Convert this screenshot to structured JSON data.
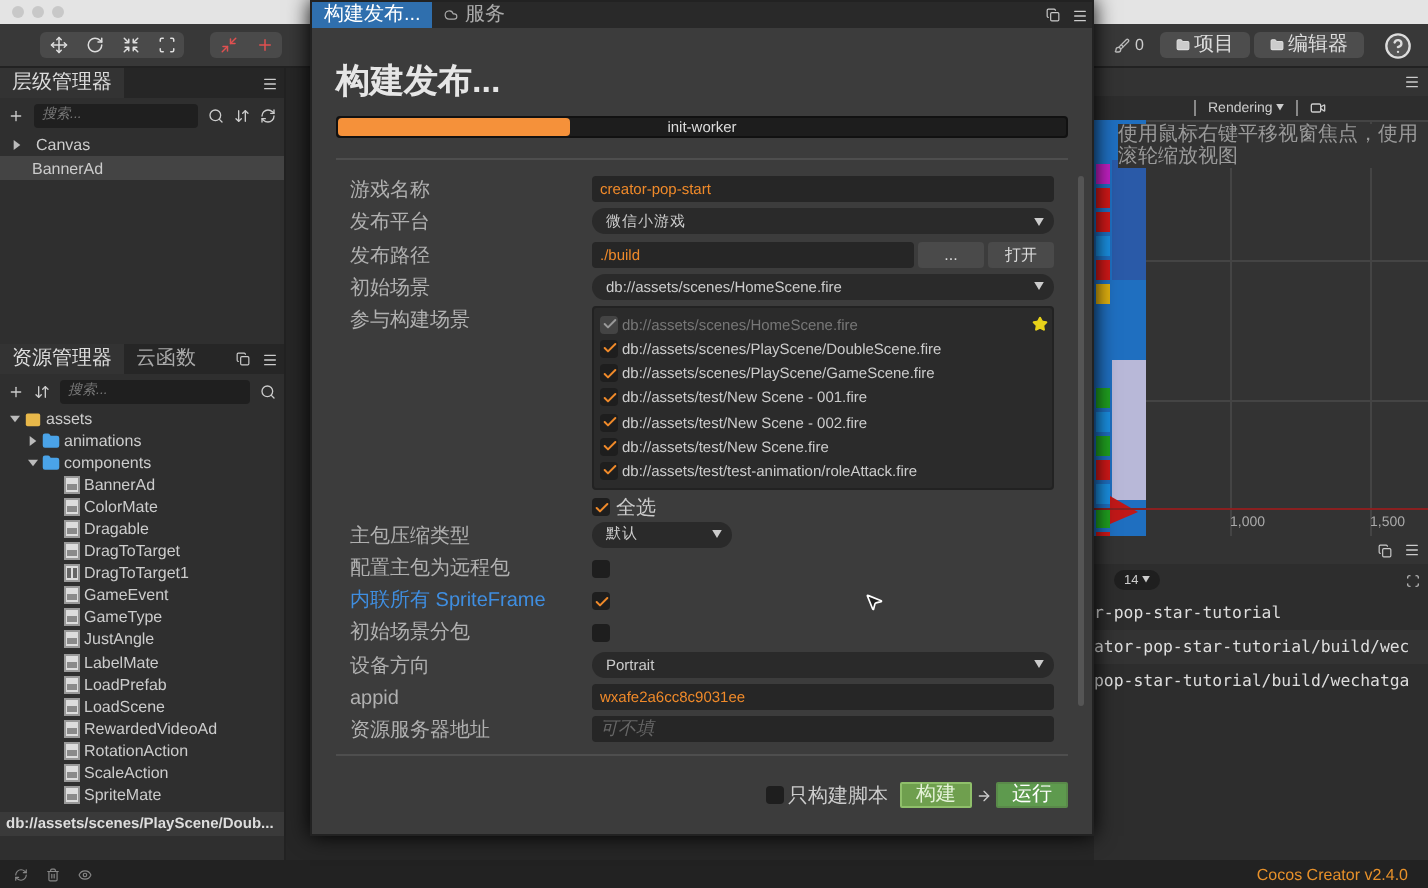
{
  "toolbar": {
    "counter": "0",
    "buttons": [
      "项目",
      "编辑器"
    ]
  },
  "hierarchy": {
    "tab": "层级管理器",
    "search": {
      "placeholder": "搜索..."
    },
    "items": [
      {
        "label": "Canvas",
        "has_caret": true,
        "selected": false
      },
      {
        "label": "BannerAd",
        "has_caret": false,
        "selected": true
      }
    ]
  },
  "assets": {
    "tabs": [
      {
        "label": "资源管理器",
        "selected": true
      },
      {
        "label": "云函数",
        "selected": false
      }
    ],
    "search": {
      "placeholder": "搜索..."
    },
    "tree": [
      {
        "label": "assets",
        "kind": "root",
        "expanded": true,
        "children": [
          {
            "label": "animations",
            "kind": "folder",
            "expanded": false
          },
          {
            "label": "components",
            "kind": "folder",
            "expanded": true,
            "children": [
              {
                "label": "BannerAd",
                "kind": "ts"
              },
              {
                "label": "ColorMate",
                "kind": "ts"
              },
              {
                "label": "Dragable",
                "kind": "ts"
              },
              {
                "label": "DragToTarget",
                "kind": "ts"
              },
              {
                "label": "DragToTarget1",
                "kind": "js"
              },
              {
                "label": "GameEvent",
                "kind": "ts"
              },
              {
                "label": "GameType",
                "kind": "ts"
              },
              {
                "label": "JustAngle",
                "kind": "ts"
              },
              {
                "label": "LabelMate",
                "kind": "ts"
              },
              {
                "label": "LoadPrefab",
                "kind": "ts"
              },
              {
                "label": "LoadScene",
                "kind": "ts"
              },
              {
                "label": "RewardedVideoAd",
                "kind": "ts"
              },
              {
                "label": "RotationAction",
                "kind": "ts"
              },
              {
                "label": "ScaleAction",
                "kind": "ts"
              },
              {
                "label": "SpriteMate",
                "kind": "ts"
              }
            ]
          }
        ]
      }
    ],
    "path": "db://assets/scenes/PlayScene/Doub..."
  },
  "scene": {
    "render_mode": "Rendering",
    "hint": "使用鼠标右键平移视窗焦点，使用滚轮缩放视图",
    "axis_labels": [
      "1,000",
      "1,500"
    ]
  },
  "console": {
    "filter": "14",
    "lines": [
      "r-pop-star-tutorial",
      "ator-pop-star-tutorial/build/wec",
      "pop-star-tutorial/build/wechatga"
    ]
  },
  "status_bar": {
    "version": "Cocos Creator v2.4.0"
  },
  "build_dialog": {
    "tabs": [
      {
        "label": "构建发布...",
        "selected": true
      },
      {
        "label": "服务",
        "selected": false
      }
    ],
    "title": "构建发布...",
    "progress": {
      "level": 0.32,
      "label": "init-worker"
    },
    "fields": [
      {
        "kind": "text",
        "label": "游戏名称",
        "value": "creator-pop-start"
      },
      {
        "kind": "select",
        "label": "发布平台",
        "value": "微信小游戏"
      },
      {
        "kind": "path",
        "label": "发布路径",
        "value": "./build",
        "buttons": [
          "...",
          "打开"
        ]
      },
      {
        "kind": "select",
        "label": "初始场景",
        "value": "db://assets/scenes/HomeScene.fire"
      },
      {
        "kind": "scenes",
        "label": "参与构建场景",
        "scenes": [
          {
            "path": "db://assets/scenes/HomeScene.fire",
            "checked": true,
            "disabled": true,
            "starred": true
          },
          {
            "path": "db://assets/scenes/PlayScene/DoubleScene.fire",
            "checked": true,
            "disabled": false,
            "starred": false
          },
          {
            "path": "db://assets/scenes/PlayScene/GameScene.fire",
            "checked": true,
            "disabled": false,
            "starred": false
          },
          {
            "path": "db://assets/test/New Scene - 001.fire",
            "checked": true,
            "disabled": false,
            "starred": false
          },
          {
            "path": "db://assets/test/New Scene - 002.fire",
            "checked": true,
            "disabled": false,
            "starred": false
          },
          {
            "path": "db://assets/test/New Scene.fire",
            "checked": true,
            "disabled": false,
            "starred": false
          },
          {
            "path": "db://assets/test/test-animation/roleAttack.fire",
            "checked": true,
            "disabled": false,
            "starred": false
          }
        ],
        "select_all": {
          "label": "全选",
          "checked": true
        }
      },
      {
        "kind": "small_select",
        "label": "主包压缩类型",
        "value": "默认"
      },
      {
        "kind": "checkbox",
        "label": "配置主包为远程包",
        "checked": false,
        "linked": false
      },
      {
        "kind": "checkbox",
        "label": "内联所有 SpriteFrame",
        "checked": true,
        "linked": true
      },
      {
        "kind": "checkbox",
        "label": "初始场景分包",
        "checked": false,
        "linked": false
      },
      {
        "kind": "select",
        "label": "设备方向",
        "value": "Portrait"
      },
      {
        "kind": "text",
        "label": "appid",
        "value": "wxafe2a6cc8c9031ee"
      },
      {
        "kind": "text",
        "label": "资源服务器地址",
        "placeholder": "可不填"
      }
    ],
    "only_scripts": {
      "label": "只构建脚本",
      "checked": false
    },
    "build_button": "构建",
    "run_button": "运行"
  }
}
